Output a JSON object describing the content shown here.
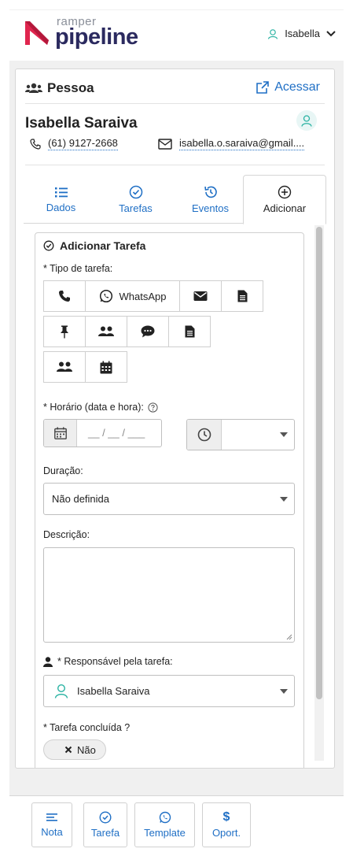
{
  "header": {
    "logo_small": "ramper",
    "logo_big": "pipeline",
    "user_name": "Isabella"
  },
  "panel": {
    "title": "Pessoa",
    "access_label": "Acessar",
    "person_name": "Isabella Saraiva",
    "phone": "(61) 9127-2668",
    "email": "isabella.o.saraiva@gmail...."
  },
  "tabs": [
    {
      "label": "Dados",
      "icon": "list-icon"
    },
    {
      "label": "Tarefas",
      "icon": "check-circle-icon"
    },
    {
      "label": "Eventos",
      "icon": "history-icon"
    },
    {
      "label": "Adicionar",
      "icon": "plus-circle-icon",
      "active": true
    }
  ],
  "form": {
    "title": "Adicionar Tarefa",
    "task_type_label": "* Tipo de tarefa:",
    "whatsapp_label": "WhatsApp",
    "datetime_label": "* Horário (data e hora):",
    "date_placeholder": "__ / __ / ___",
    "duration_label": "Duração:",
    "duration_value": "Não definida",
    "description_label": "Descrição:",
    "responsible_label": "* Responsável pela tarefa:",
    "responsible_value": "Isabella Saraiva",
    "done_label": "* Tarefa concluída ?",
    "done_value": "Não"
  },
  "bottom": [
    {
      "label": "Nota",
      "icon": "note-icon"
    },
    {
      "label": "Tarefa",
      "icon": "check-circle-icon"
    },
    {
      "label": "Template",
      "icon": "whatsapp-icon"
    },
    {
      "label": "Oport.",
      "icon": "dollar-icon"
    }
  ],
  "colors": {
    "accent": "#1f6fc5",
    "brand_red": "#e0254e",
    "brand_navy": "#2b2a5f"
  }
}
